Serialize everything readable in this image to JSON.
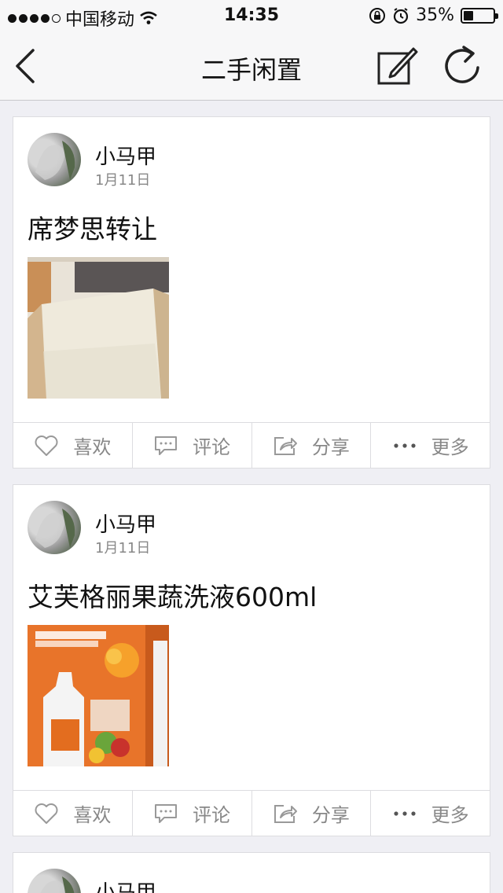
{
  "status_bar": {
    "carrier": "中国移动",
    "time": "14:35",
    "battery_percent": "35%"
  },
  "nav": {
    "title": "二手闲置",
    "back_icon": "chevron-left-icon",
    "compose_icon": "compose-icon",
    "refresh_icon": "refresh-icon"
  },
  "posts": [
    {
      "username": "小马甲",
      "date": "1月11日",
      "title": "席梦思转让",
      "image": "mattress-photo"
    },
    {
      "username": "小马甲",
      "date": "1月11日",
      "title": "艾芙格丽果蔬洗液600ml",
      "image": "detergent-photo"
    },
    {
      "username": "小马甲",
      "date": "",
      "title": "",
      "image": ""
    }
  ],
  "actions": {
    "like": "喜欢",
    "comment": "评论",
    "share": "分享",
    "more": "更多"
  }
}
